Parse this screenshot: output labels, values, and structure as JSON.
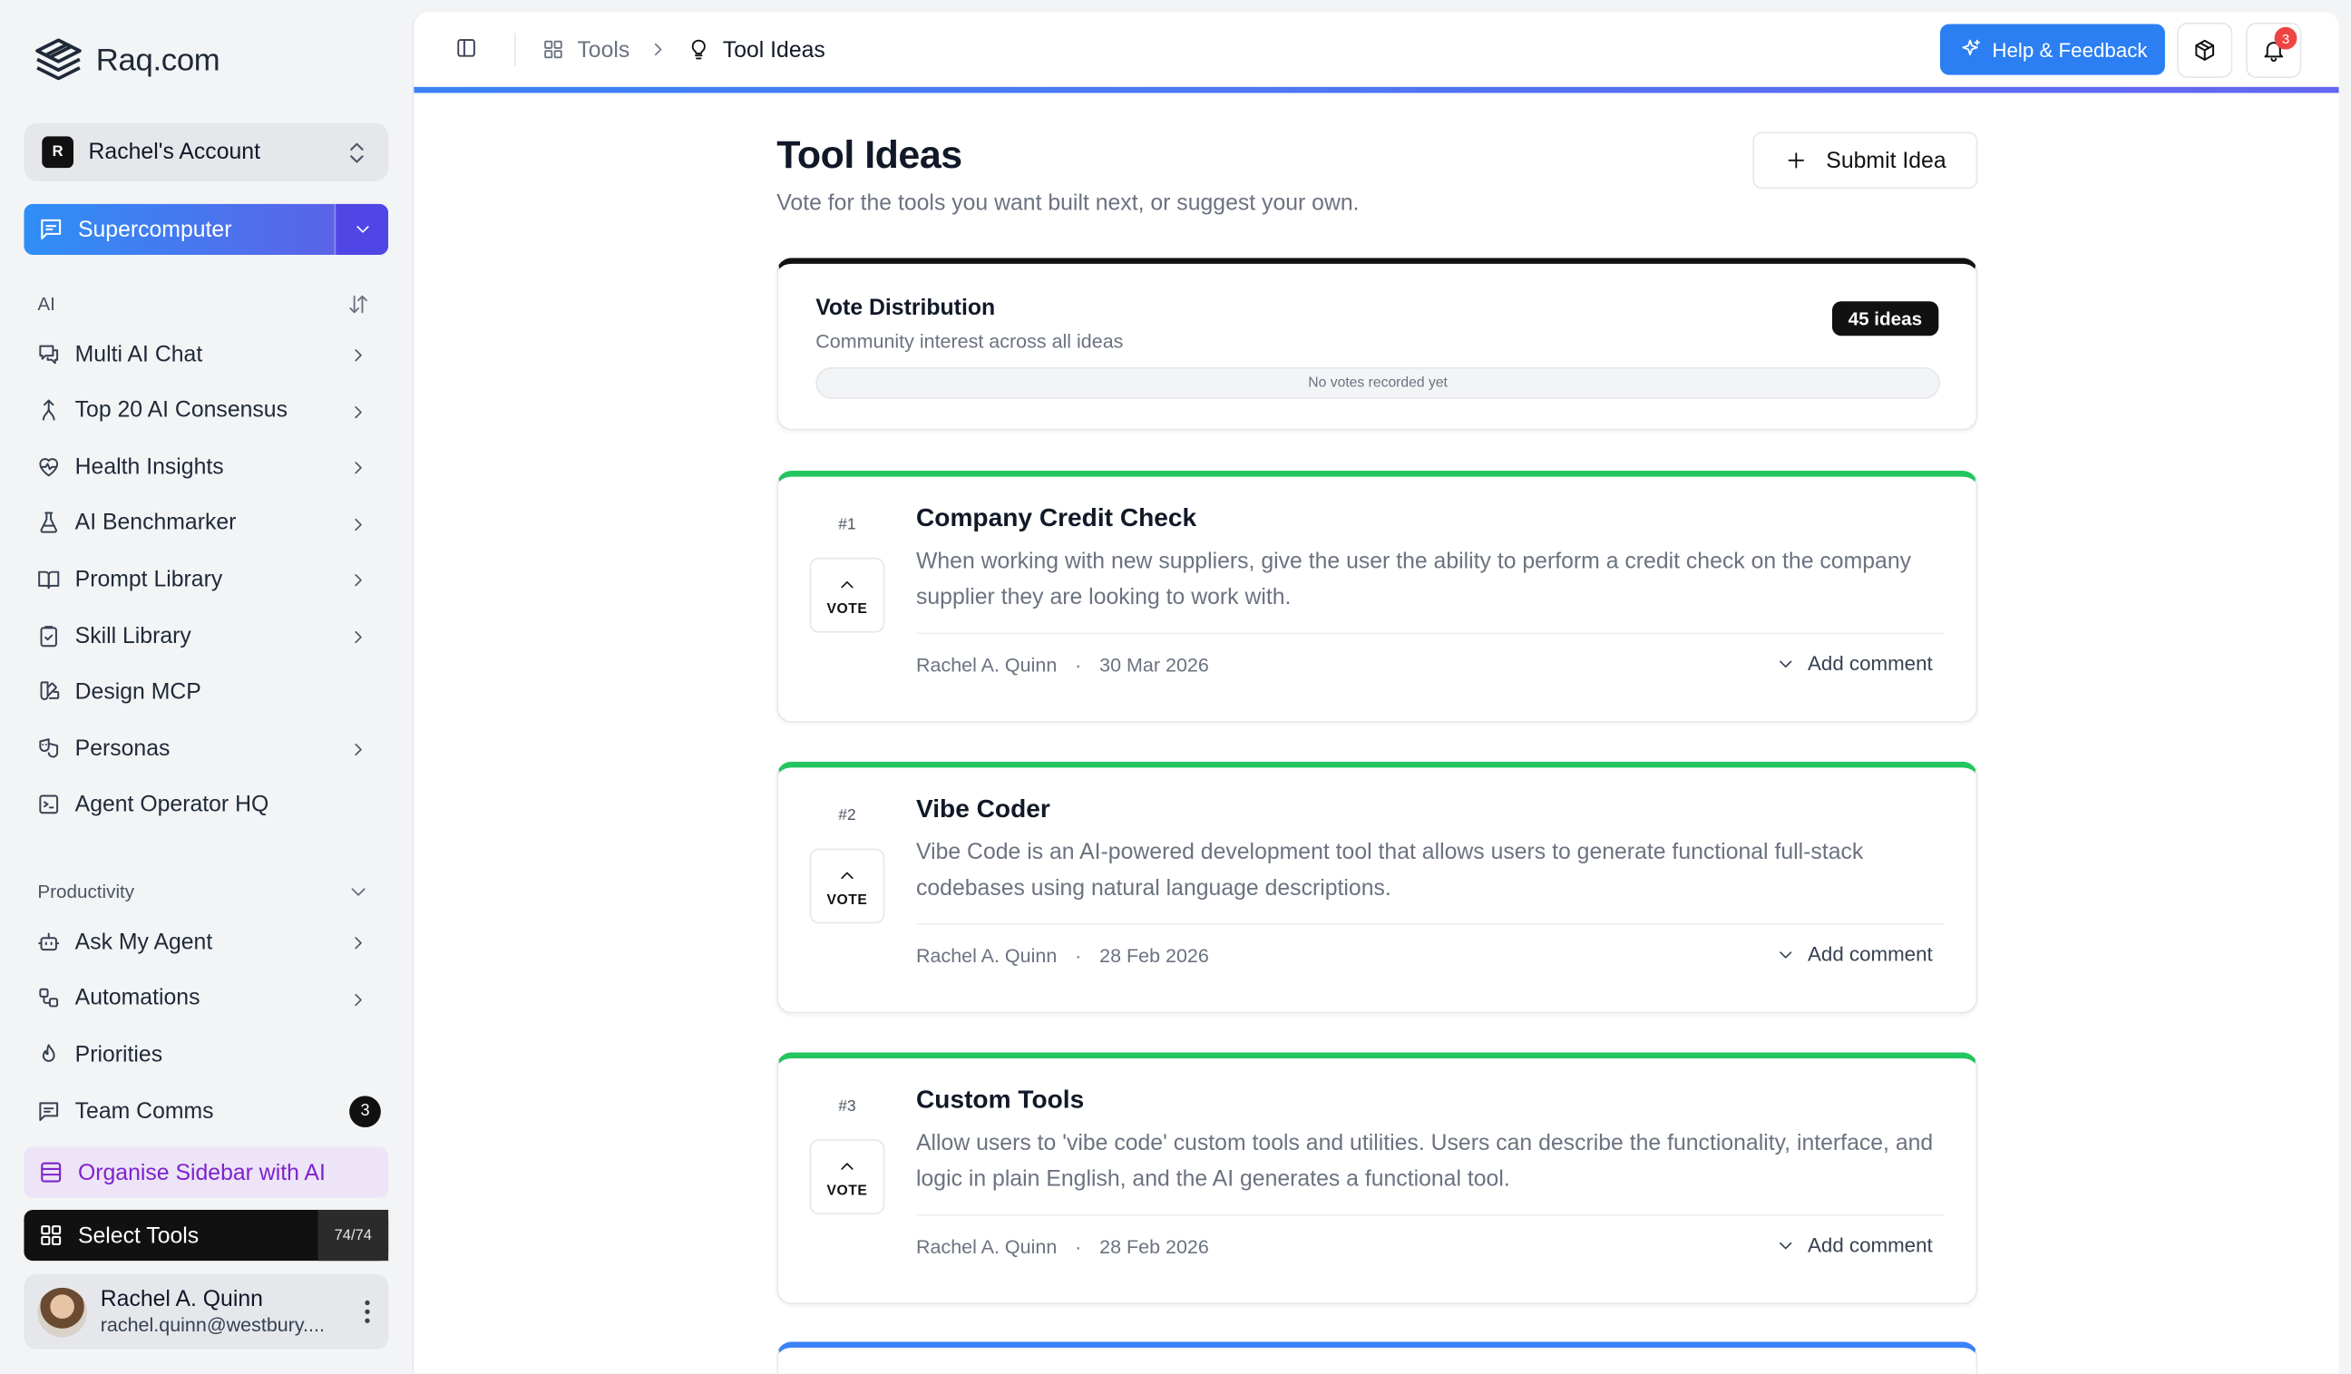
{
  "brand": {
    "name": "Raq.com"
  },
  "account": {
    "initial": "R",
    "name": "Rachel's Account"
  },
  "supercomputer": {
    "label": "Supercomputer"
  },
  "sidebar": {
    "ai_section": {
      "title": "AI",
      "items": [
        {
          "label": "Multi AI Chat",
          "icon": "chat-bubbles-icon",
          "chevron": true
        },
        {
          "label": "Top 20 AI Consensus",
          "icon": "merge-icon",
          "chevron": true
        },
        {
          "label": "Health Insights",
          "icon": "heart-pulse-icon",
          "chevron": true
        },
        {
          "label": "AI Benchmarker",
          "icon": "flask-icon",
          "chevron": true
        },
        {
          "label": "Prompt Library",
          "icon": "book-open-icon",
          "chevron": true
        },
        {
          "label": "Skill Library",
          "icon": "clipboard-check-icon",
          "chevron": true
        },
        {
          "label": "Design MCP",
          "icon": "palette-icon",
          "chevron": false
        },
        {
          "label": "Personas",
          "icon": "drama-masks-icon",
          "chevron": true
        },
        {
          "label": "Agent Operator HQ",
          "icon": "terminal-icon",
          "chevron": false
        }
      ]
    },
    "productivity_section": {
      "title": "Productivity",
      "items": [
        {
          "label": "Ask My Agent",
          "icon": "bot-icon",
          "chevron": true
        },
        {
          "label": "Automations",
          "icon": "workflow-icon",
          "chevron": true
        },
        {
          "label": "Priorities",
          "icon": "flame-icon",
          "chevron": false
        },
        {
          "label": "Team Comms",
          "icon": "message-square-icon",
          "chevron": false,
          "badge": "3"
        }
      ]
    },
    "organise_label": "Organise Sidebar with AI",
    "select_tools": {
      "label": "Select Tools",
      "count": "74/74"
    },
    "user": {
      "name": "Rachel A. Quinn",
      "email": "rachel.quinn@westbury...."
    }
  },
  "topbar": {
    "breadcrumb": {
      "parent": "Tools",
      "current": "Tool Ideas"
    },
    "help_label": "Help & Feedback",
    "notifications_count": "3"
  },
  "page": {
    "title": "Tool Ideas",
    "subtitle": "Vote for the tools you want built next, or suggest your own.",
    "submit_label": "Submit Idea"
  },
  "vote_distribution": {
    "title": "Vote Distribution",
    "subtitle": "Community interest across all ideas",
    "badge": "45 ideas",
    "empty_text": "No votes recorded yet"
  },
  "ideas": [
    {
      "rank": "#1",
      "vote_label": "VOTE",
      "title": "Company Credit Check",
      "description": "When working with new suppliers, give the user the ability to perform a credit check on the company supplier they are looking to work with.",
      "author": "Rachel A. Quinn",
      "date": "30 Mar 2026",
      "comment_label": "Add comment"
    },
    {
      "rank": "#2",
      "vote_label": "VOTE",
      "title": "Vibe Coder",
      "description": "Vibe Code is an AI-powered development tool that allows users to generate functional full-stack codebases using natural language descriptions.",
      "author": "Rachel A. Quinn",
      "date": "28 Feb 2026",
      "comment_label": "Add comment"
    },
    {
      "rank": "#3",
      "vote_label": "VOTE",
      "title": "Custom Tools",
      "description": "Allow users to 'vibe code' custom tools and utilities. Users can describe the functionality, interface, and logic in plain English, and the AI generates a functional tool.",
      "author": "Rachel A. Quinn",
      "date": "28 Feb 2026",
      "comment_label": "Add comment"
    }
  ],
  "colors": {
    "accent_blue": "#2b7ff2",
    "idea_border": "#22c55e",
    "organise_text": "#7e22ce"
  }
}
